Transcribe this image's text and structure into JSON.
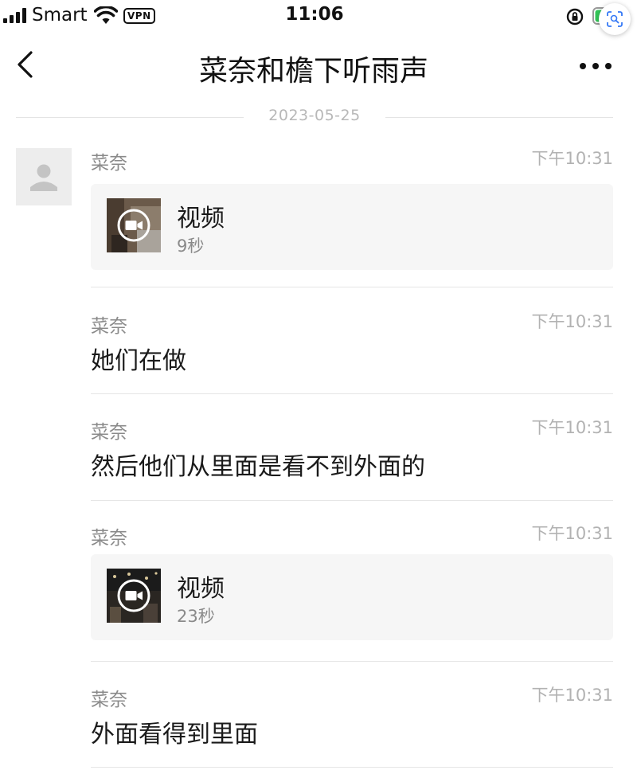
{
  "status_bar": {
    "carrier": "Smart",
    "vpn": "VPN",
    "time": "11:06",
    "icons": [
      "signal-icon",
      "wifi-icon",
      "rotation-lock-icon",
      "battery-charging-icon",
      "scan-text-icon"
    ]
  },
  "nav": {
    "title": "菜奈和檐下听雨声",
    "back_icon": "chevron-left-icon",
    "more_icon": "more-dots-icon"
  },
  "date_divider": "2023-05-25",
  "colors": {
    "background": "#ffffff",
    "card": "#f6f6f6",
    "muted_text": "#8a8a8a",
    "time_text": "#b2b2b2",
    "divider": "#e6e6e6"
  },
  "messages": [
    {
      "sender": "菜奈",
      "time": "下午10:31",
      "type": "video",
      "label": "视频",
      "duration": "9秒"
    },
    {
      "sender": "菜奈",
      "time": "下午10:31",
      "type": "text",
      "text": "她们在做"
    },
    {
      "sender": "菜奈",
      "time": "下午10:31",
      "type": "text",
      "text": "然后他们从里面是看不到外面的"
    },
    {
      "sender": "菜奈",
      "time": "下午10:31",
      "type": "video",
      "label": "视频",
      "duration": "23秒"
    },
    {
      "sender": "菜奈",
      "time": "下午10:31",
      "type": "text",
      "text": "外面看得到里面"
    }
  ]
}
